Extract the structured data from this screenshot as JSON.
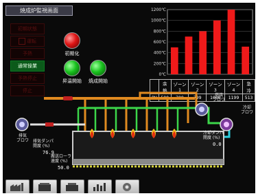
{
  "title": "焼成炉監視画面",
  "menu": [
    {
      "label": "初期状態",
      "active": false,
      "check": false
    },
    {
      "label": "運転",
      "active": false,
      "check": true
    },
    {
      "label": "予熱",
      "active": false,
      "check": false
    },
    {
      "label": "通常操業",
      "active": true,
      "check": false
    },
    {
      "label": "予熱停止",
      "active": false,
      "check": false
    },
    {
      "label": "停止",
      "active": false,
      "check": false
    }
  ],
  "lamps": {
    "init": {
      "label": "初期化",
      "color": "red"
    },
    "temp_rise": {
      "label": "昇温開始",
      "color": "green"
    },
    "firing": {
      "label": "焼成開始",
      "color": "green"
    }
  },
  "chart_data": {
    "type": "bar",
    "ylabels": [
      "1200℃",
      "1000℃",
      "800℃",
      "600℃",
      "400℃",
      "200℃",
      "0℃"
    ],
    "ylim": [
      0,
      1200
    ],
    "categories": [
      "余熱ゾーン",
      "ゾーン1",
      "ゾーン2",
      "ゾーン3",
      "ゾーン4",
      "急冷ゾーン"
    ],
    "values": [
      500,
      700,
      799,
      1000,
      1199,
      513
    ],
    "colors": {
      "bar": "#ef1a1a",
      "grid": "#4a4a4a",
      "frame": "#9a9a9a"
    }
  },
  "pv_table": {
    "row_label": "PV",
    "headers": [
      "余熱",
      "ゾーン1",
      "ゾーン2",
      "ゾーン3",
      "ゾーン4",
      "急冷"
    ],
    "values": [
      "500",
      "700",
      "799",
      "1000",
      "1199",
      "513"
    ]
  },
  "process": {
    "fan_exhaust": "排気\nブロワ",
    "fan_combustion": "燃焼\nブロワ",
    "fan_cooling": "冷却\nブロワ",
    "damper_exhaust_label": "排気ダンパ\n開度 (%)",
    "damper_exhaust_value": "76.9",
    "damper_cooling_label": "冷却ダンパ\n開度 (%)",
    "damper_cooling_value": "0.0",
    "conveyor_label": "搬送ローラ\n速度 (%)",
    "conveyor_value": "50.0",
    "burner_count": 6
  },
  "toolbar": [
    {
      "icon": "factory-icon"
    },
    {
      "icon": "furnace-icon"
    },
    {
      "icon": "furnace-alt-icon"
    },
    {
      "icon": "trend-chart-icon"
    },
    {
      "icon": "settings-disk-icon"
    }
  ]
}
